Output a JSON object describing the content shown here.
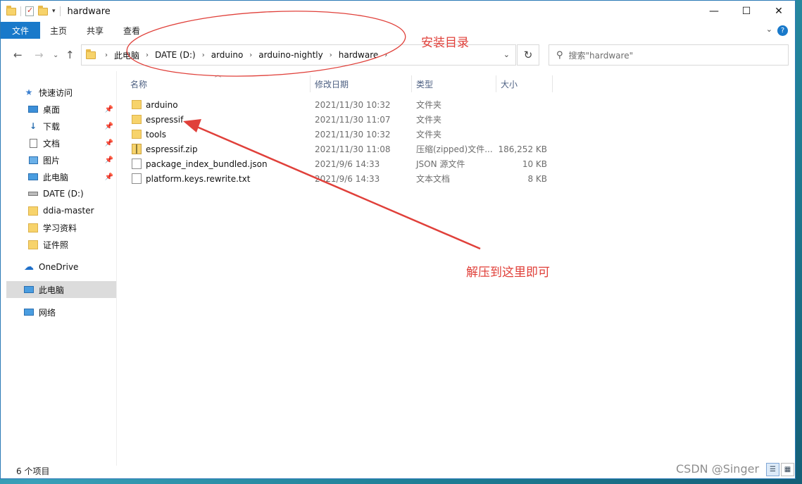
{
  "window": {
    "title": "hardware",
    "controls": {
      "minimize": "—",
      "maximize": "☐",
      "close": "✕"
    }
  },
  "ribbon": {
    "tabs": [
      "文件",
      "主页",
      "共享",
      "查看"
    ],
    "help": "?",
    "expand": "⌄"
  },
  "nav": {
    "back": "←",
    "forward": "→",
    "recent": "⌄",
    "up": "↑"
  },
  "address": {
    "breadcrumbs": [
      "此电脑",
      "DATE (D:)",
      "arduino",
      "arduino-nightly",
      "hardware"
    ],
    "refresh": "↻"
  },
  "search": {
    "placeholder": "搜索\"hardware\""
  },
  "sidebar": {
    "items": [
      {
        "label": "快速访问",
        "icon": "star-icon"
      },
      {
        "label": "桌面",
        "icon": "desktop-icon",
        "pinned": true
      },
      {
        "label": "下载",
        "icon": "download-icon",
        "pinned": true
      },
      {
        "label": "文档",
        "icon": "document-icon",
        "pinned": true
      },
      {
        "label": "图片",
        "icon": "picture-icon",
        "pinned": true
      },
      {
        "label": "此电脑",
        "icon": "computer-icon",
        "pinned": true
      },
      {
        "label": "DATE (D:)",
        "icon": "drive-icon"
      },
      {
        "label": "ddia-master",
        "icon": "folder-icon"
      },
      {
        "label": "学习资料",
        "icon": "folder-icon"
      },
      {
        "label": "证件照",
        "icon": "folder-icon"
      },
      {
        "label": "OneDrive",
        "icon": "cloud-icon"
      },
      {
        "label": "此电脑",
        "icon": "computer-icon",
        "selected": true
      },
      {
        "label": "网络",
        "icon": "network-icon"
      }
    ]
  },
  "columns": {
    "name": "名称",
    "date": "修改日期",
    "type": "类型",
    "size": "大小"
  },
  "files": [
    {
      "name": "arduino",
      "date": "2021/11/30 10:32",
      "type": "文件夹",
      "size": "",
      "icon": "folder-icon"
    },
    {
      "name": "espressif",
      "date": "2021/11/30 11:07",
      "type": "文件夹",
      "size": "",
      "icon": "folder-icon"
    },
    {
      "name": "tools",
      "date": "2021/11/30 10:32",
      "type": "文件夹",
      "size": "",
      "icon": "folder-icon"
    },
    {
      "name": "espressif.zip",
      "date": "2021/11/30 11:08",
      "type": "压缩(zipped)文件...",
      "size": "186,252 KB",
      "icon": "zip-icon"
    },
    {
      "name": "package_index_bundled.json",
      "date": "2021/9/6 14:33",
      "type": "JSON 源文件",
      "size": "10 KB",
      "icon": "json-file-icon"
    },
    {
      "name": "platform.keys.rewrite.txt",
      "date": "2021/9/6 14:33",
      "type": "文本文档",
      "size": "8 KB",
      "icon": "text-file-icon"
    }
  ],
  "status": {
    "count": "6 个项目"
  },
  "annotations": {
    "install_dir": "安装目录",
    "extract_here": "解压到这里即可",
    "color": "#e0403a"
  },
  "watermark": "CSDN @Singer"
}
